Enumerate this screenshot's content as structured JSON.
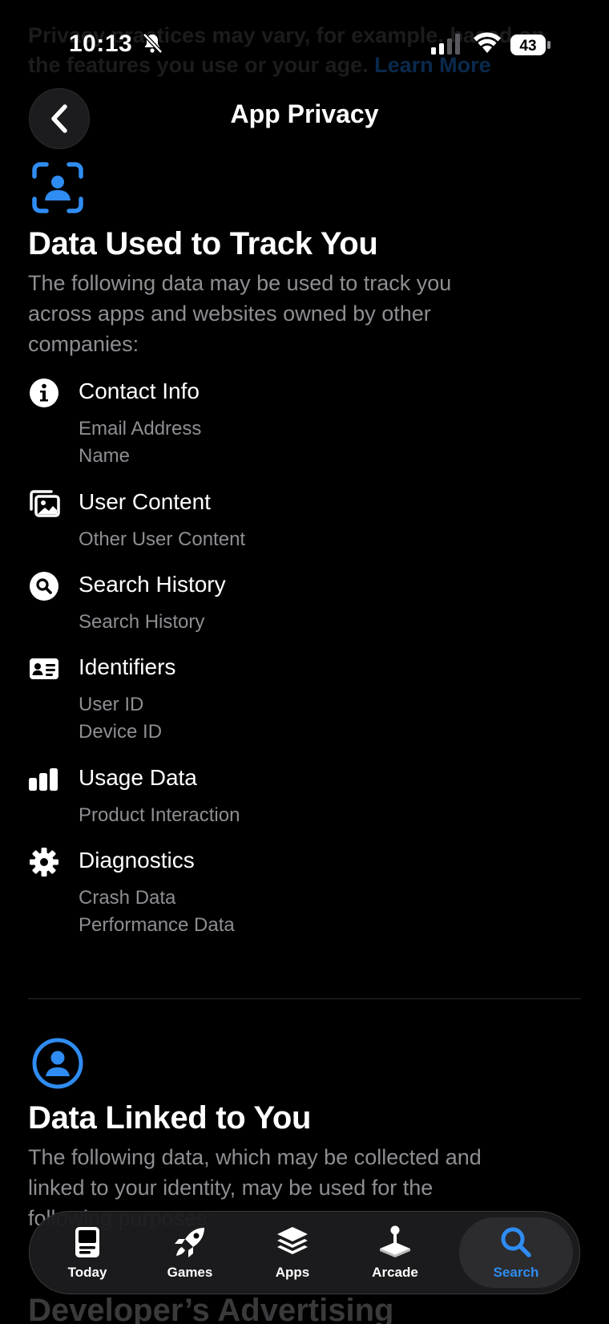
{
  "behind": {
    "line1": "Privacy practices may vary, for example, based on",
    "line2": "the features you use or your age.",
    "link": "Learn More"
  },
  "status_bar": {
    "time": "10:13",
    "battery": "43"
  },
  "header": {
    "title": "App Privacy"
  },
  "track_section": {
    "title": "Data Used to Track You",
    "description_lines": [
      "The following data may be used to track you",
      "across apps and websites owned by other",
      "companies:"
    ],
    "categories": [
      {
        "title": "Contact Info",
        "icon": "info-circle-icon",
        "items": [
          "Email Address",
          "Name"
        ]
      },
      {
        "title": "User Content",
        "icon": "photos-icon",
        "items": [
          "Other User Content"
        ]
      },
      {
        "title": "Search History",
        "icon": "search-circle-icon",
        "items": [
          "Search History"
        ]
      },
      {
        "title": "Identifiers",
        "icon": "id-card-icon",
        "items": [
          "User ID",
          "Device ID"
        ]
      },
      {
        "title": "Usage Data",
        "icon": "bar-chart-icon",
        "items": [
          "Product Interaction"
        ]
      },
      {
        "title": "Diagnostics",
        "icon": "gear-icon",
        "items": [
          "Crash Data",
          "Performance Data"
        ]
      }
    ]
  },
  "linked_section": {
    "title": "Data Linked to You",
    "description_lines": [
      "The following data, which may be collected and",
      "linked to your identity, may be used for the",
      "following purposes:"
    ]
  },
  "next_heading": "Developer’s Advertising",
  "tabs": [
    {
      "label": "Today",
      "icon": "today-icon",
      "active": false
    },
    {
      "label": "Games",
      "icon": "rocket-icon",
      "active": false
    },
    {
      "label": "Apps",
      "icon": "apps-stack-icon",
      "active": false
    },
    {
      "label": "Arcade",
      "icon": "joystick-icon",
      "active": false
    },
    {
      "label": "Search",
      "icon": "search-icon",
      "active": true
    }
  ],
  "colors": {
    "accent": "#2f8cf2",
    "secondary_text": "#8e8e93",
    "background": "#000000"
  }
}
